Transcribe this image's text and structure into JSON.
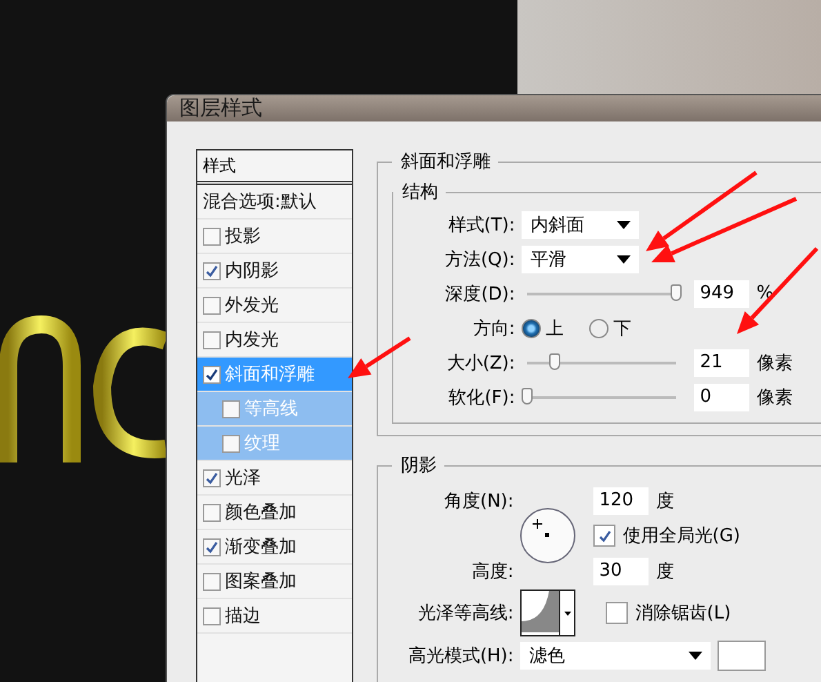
{
  "window": {
    "title": "图层样式"
  },
  "styles_list": {
    "header": "样式",
    "blending": "混合选项:默认",
    "items": [
      {
        "label": "投影",
        "checked": false,
        "selected": false
      },
      {
        "label": "内阴影",
        "checked": true,
        "selected": false
      },
      {
        "label": "外发光",
        "checked": false,
        "selected": false
      },
      {
        "label": "内发光",
        "checked": false,
        "selected": false
      },
      {
        "label": "斜面和浮雕",
        "checked": true,
        "selected": true,
        "children": [
          {
            "label": "等高线",
            "checked": false
          },
          {
            "label": "纹理",
            "checked": false
          }
        ]
      },
      {
        "label": "光泽",
        "checked": true,
        "selected": false
      },
      {
        "label": "颜色叠加",
        "checked": false,
        "selected": false
      },
      {
        "label": "渐变叠加",
        "checked": true,
        "selected": false
      },
      {
        "label": "图案叠加",
        "checked": false,
        "selected": false
      },
      {
        "label": "描边",
        "checked": false,
        "selected": false
      }
    ]
  },
  "bevel": {
    "title": "斜面和浮雕",
    "structure": {
      "title": "结构",
      "rows": [
        {
          "kind": "select",
          "label": "样式(T):",
          "value": "内斜面"
        },
        {
          "kind": "select",
          "label": "方法(Q):",
          "value": "平滑"
        },
        {
          "kind": "slider",
          "label": "深度(D):",
          "level": 1.0,
          "value": "949",
          "unit": "%"
        },
        {
          "kind": "radio",
          "label": "方向:",
          "options": [
            {
              "label": "上",
              "selected": true
            },
            {
              "label": "下",
              "selected": false
            }
          ]
        },
        {
          "kind": "slider",
          "label": "大小(Z):",
          "level": 0.18,
          "value": "21",
          "unit": "像素"
        },
        {
          "kind": "slider",
          "label": "软化(F):",
          "level": 0,
          "value": "0",
          "unit": "像素"
        }
      ]
    }
  },
  "shading": {
    "title": "阴影",
    "angle": {
      "label": "角度(N):",
      "value": "120",
      "unit": "度"
    },
    "global_light": {
      "label": "使用全局光(G)",
      "checked": true
    },
    "altitude": {
      "label": "高度:",
      "value": "30",
      "unit": "度"
    },
    "gloss_contour": {
      "label": "光泽等高线:"
    },
    "anti_aliased": {
      "label": "消除锯齿(L)",
      "checked": false
    },
    "highlight_mode": {
      "label": "高光模式(H):",
      "value": "滤色"
    }
  }
}
